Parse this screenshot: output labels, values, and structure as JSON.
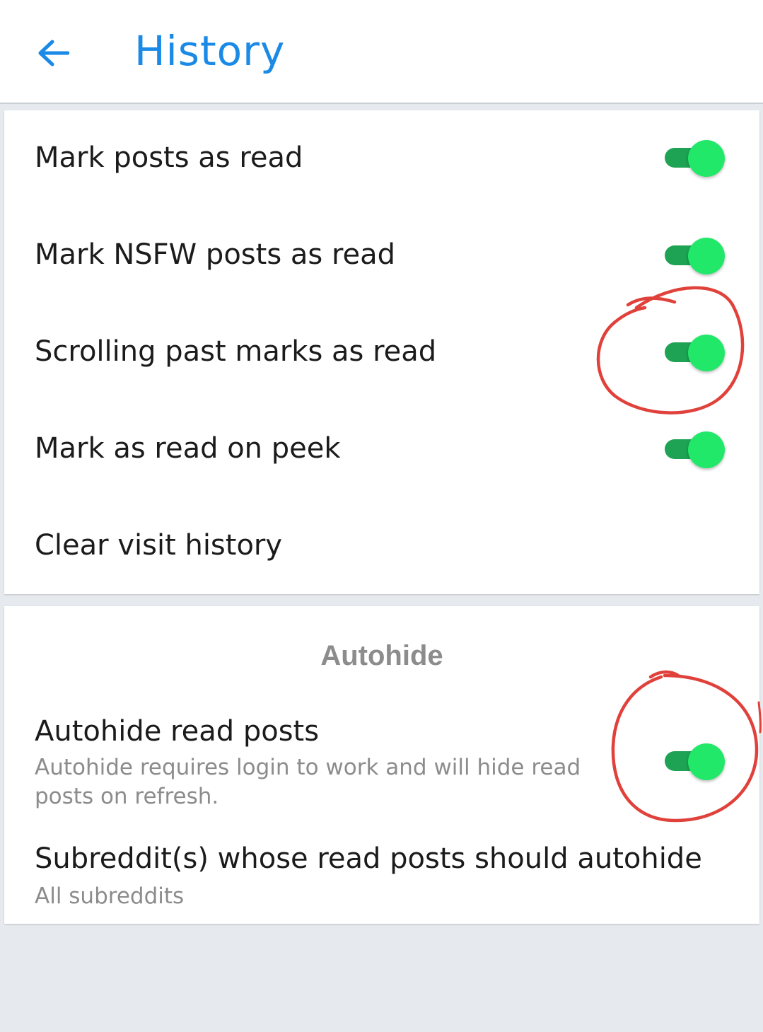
{
  "header": {
    "back_icon": "arrow-left-icon",
    "title": "History",
    "accent_color": "#1a8ae6"
  },
  "history_settings": [
    {
      "label": "Mark posts as read",
      "toggle_on": true
    },
    {
      "label": "Mark NSFW posts as read",
      "toggle_on": true
    },
    {
      "label": "Scrolling past marks as read",
      "toggle_on": true
    },
    {
      "label": "Mark as read on peek",
      "toggle_on": true
    },
    {
      "label": "Clear visit history"
    }
  ],
  "autohide": {
    "section_title": "Autohide",
    "read_posts": {
      "label": "Autohide read posts",
      "description": "Autohide requires login to work and will hide read posts on refresh.",
      "toggle_on": true
    },
    "subreddits": {
      "label": "Subreddit(s) whose read posts should autohide",
      "value": "All subreddits"
    }
  },
  "colors": {
    "toggle_track": "#1ea354",
    "toggle_thumb": "#22e86a",
    "annotation": "#e0413b"
  }
}
